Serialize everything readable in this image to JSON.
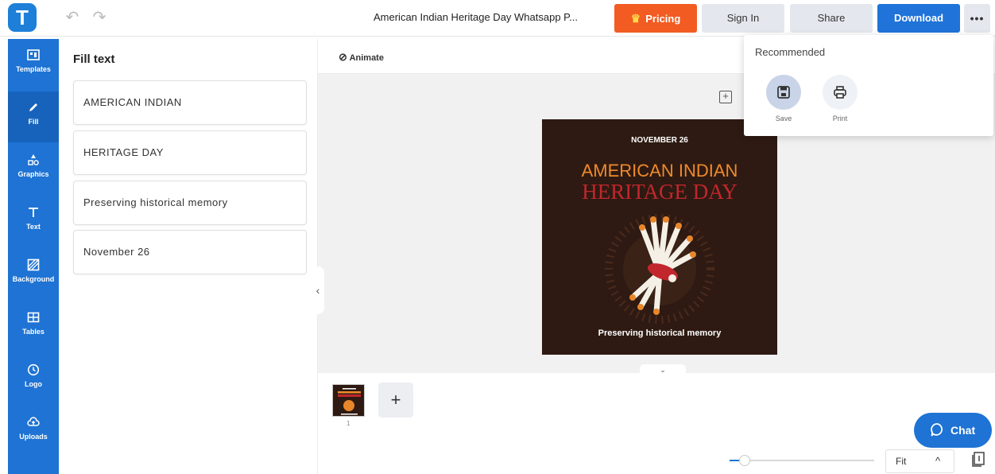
{
  "app": {
    "logo_letter": "T",
    "doc_title": "American Indian Heritage Day Whatsapp P..."
  },
  "toolbar": {
    "undo_icon": "↶",
    "redo_icon": "↷",
    "pricing_label": "Pricing",
    "signin_label": "Sign In",
    "share_label": "Share",
    "download_label": "Download",
    "more_label": "•••",
    "accent_color": "#1f73d9",
    "pricing_color": "#f25c22"
  },
  "sidebar": {
    "items": [
      {
        "label": "Templates",
        "icon": "templates-icon"
      },
      {
        "label": "Fill",
        "icon": "pencil-icon"
      },
      {
        "label": "Graphics",
        "icon": "shapes-icon"
      },
      {
        "label": "Text",
        "icon": "text-icon"
      },
      {
        "label": "Background",
        "icon": "background-icon"
      },
      {
        "label": "Tables",
        "icon": "table-icon"
      },
      {
        "label": "Logo",
        "icon": "logo-icon"
      },
      {
        "label": "Uploads",
        "icon": "upload-cloud-icon"
      }
    ]
  },
  "fill_panel": {
    "title": "Fill text",
    "fields": [
      "AMERICAN INDIAN",
      "HERITAGE DAY",
      "Preserving historical memory",
      "November 26"
    ]
  },
  "canvas": {
    "animate_label": "Animate",
    "design": {
      "date": "NOVEMBER 26",
      "title_line1": "AMERICAN INDIAN",
      "title_line2": "HERITAGE DAY",
      "subtitle": "Preserving historical memory"
    }
  },
  "pages": {
    "thumb_number": "1",
    "add_label": "+"
  },
  "zoom": {
    "value_label": "Fit",
    "chevron": "^"
  },
  "chat": {
    "label": "Chat"
  },
  "download_menu": {
    "heading": "Recommended",
    "options": [
      {
        "label": "Save",
        "icon": "save-icon"
      },
      {
        "label": "Print",
        "icon": "print-icon"
      }
    ]
  }
}
